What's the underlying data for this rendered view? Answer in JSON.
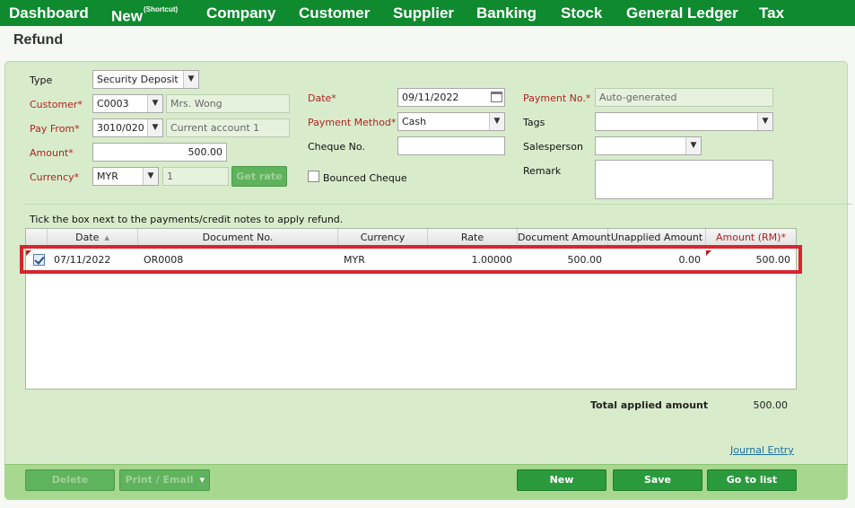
{
  "nav": {
    "items": [
      {
        "label": "Dashboard"
      },
      {
        "label": "New",
        "sup": "(Shortcut)"
      },
      {
        "label": "Company"
      },
      {
        "label": "Customer"
      },
      {
        "label": "Supplier"
      },
      {
        "label": "Banking"
      },
      {
        "label": "Stock"
      },
      {
        "label": "General Ledger"
      },
      {
        "label": "Tax"
      }
    ]
  },
  "page": {
    "title": "Refund"
  },
  "form": {
    "type": {
      "label": "Type",
      "value": "Security Deposit"
    },
    "customer": {
      "label": "Customer*",
      "code": "C0003",
      "name": "Mrs. Wong"
    },
    "pay_from": {
      "label": "Pay From*",
      "code": "3010/020",
      "name": "Current account 1"
    },
    "amount": {
      "label": "Amount*",
      "value": "500.00"
    },
    "currency": {
      "label": "Currency*",
      "value": "MYR",
      "rate": "1",
      "get_rate_label": "Get rate"
    },
    "date": {
      "label": "Date*",
      "value": "09/11/2022"
    },
    "payment_method": {
      "label": "Payment Method*",
      "value": "Cash"
    },
    "cheque_no": {
      "label": "Cheque No.",
      "value": ""
    },
    "bounced_cheque": {
      "label": "Bounced Cheque",
      "checked": false
    },
    "payment_no": {
      "label": "Payment No.*",
      "value": "Auto-generated"
    },
    "tags": {
      "label": "Tags",
      "value": ""
    },
    "salesperson": {
      "label": "Salesperson",
      "value": ""
    },
    "remark": {
      "label": "Remark",
      "value": ""
    }
  },
  "grid": {
    "instruction": "Tick the box next to the payments/credit notes to apply refund.",
    "columns": {
      "date": "Date",
      "document_no": "Document No.",
      "currency": "Currency",
      "rate": "Rate",
      "document_amount": "Document Amount",
      "unapplied_amount": "Unapplied Amount",
      "amount_rm": "Amount (RM)*"
    },
    "rows": [
      {
        "checked": true,
        "date": "07/11/2022",
        "document_no": "OR0008",
        "currency": "MYR",
        "rate": "1.00000",
        "document_amount": "500.00",
        "unapplied_amount": "0.00",
        "amount_rm": "500.00"
      }
    ]
  },
  "totals": {
    "label": "Total applied amount",
    "value": "500.00"
  },
  "links": {
    "journal_entry": "Journal Entry"
  },
  "buttons": {
    "delete": "Delete",
    "print_email": "Print / Email",
    "new": "New",
    "save": "Save",
    "go_to_list": "Go to list"
  },
  "colors": {
    "nav_bg": "#0f8a2f",
    "panel_bg": "#d8eccc",
    "button_green": "#2b9a3d",
    "required_label": "#b02222",
    "highlight_red": "#d8252e"
  }
}
